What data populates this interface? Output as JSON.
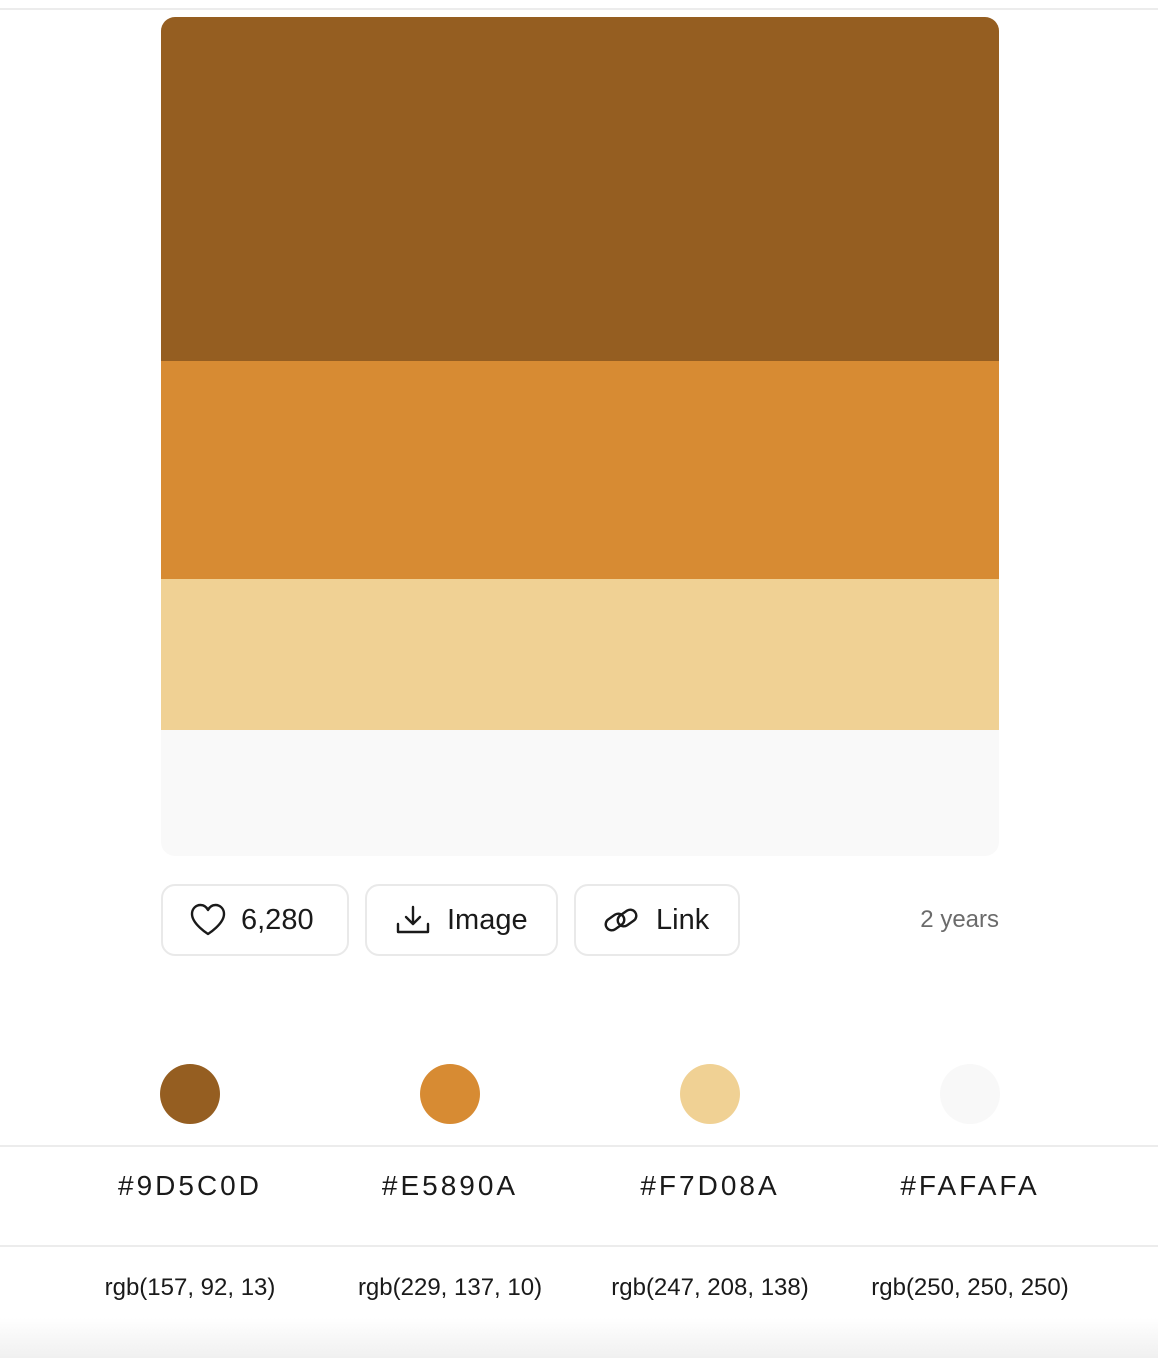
{
  "palette": {
    "colors": [
      "#955E21",
      "#D78B33",
      "#F0D194",
      "#F9F9F9"
    ]
  },
  "actions": {
    "likes_count": "6,280",
    "image_label": "Image",
    "link_label": "Link",
    "age": "2 years"
  },
  "swatches": [
    {
      "dot_color": "#955E21",
      "hex": "#9D5C0D",
      "rgb": "rgb(157, 92, 13)"
    },
    {
      "dot_color": "#D78B33",
      "hex": "#E5890A",
      "rgb": "rgb(229, 137, 10)"
    },
    {
      "dot_color": "#F0D194",
      "hex": "#F7D08A",
      "rgb": "rgb(247, 208, 138)"
    },
    {
      "dot_color": "#F8F8F8",
      "hex": "#FAFAFA",
      "rgb": "rgb(250, 250, 250)"
    }
  ],
  "icons": {
    "like": "heart-icon",
    "image": "download-icon",
    "link": "link-icon"
  }
}
